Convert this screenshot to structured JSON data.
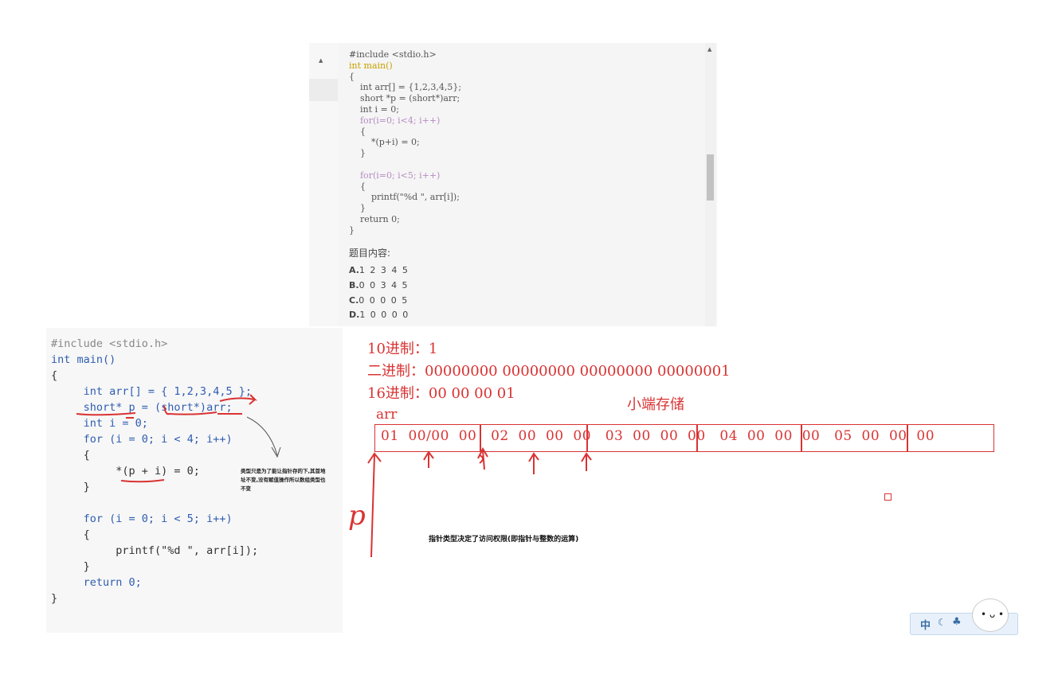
{
  "top_panel": {
    "code_lines": [
      "#include <stdio.h>",
      "int main()",
      "{",
      "    int arr[] = {1,2,3,4,5};",
      "    short *p = (short*)arr;",
      "    int i = 0;",
      "    for(i=0; i<4; i++)",
      "    {",
      "        *(p+i) = 0;",
      "    }",
      "",
      "    for(i=0; i<5; i++)",
      "    {",
      "        printf(\"%d \", arr[i]);",
      "    }",
      "    return 0;",
      "}"
    ],
    "question_label": "题目内容:",
    "options": [
      {
        "letter": "A.",
        "text": "1 2 3 4 5"
      },
      {
        "letter": "B.",
        "text": "0 0 3 4 5"
      },
      {
        "letter": "C.",
        "text": "0 0 0 0 5"
      },
      {
        "letter": "D.",
        "text": "1 0 0 0 0"
      }
    ]
  },
  "bottom_panel": {
    "code_lines": [
      "#include <stdio.h>",
      "int main()",
      "{",
      "     int arr[] = { 1,2,3,4,5 };",
      "     short* p = (short*)arr;",
      "     int i = 0;",
      "     for (i = 0; i < 4; i++)",
      "     {",
      "          *(p + i) = 0;",
      "     }",
      "",
      "     for (i = 0; i < 5; i++)",
      "     {",
      "          printf(\"%d \", arr[i]);",
      "     }",
      "     return 0;",
      "}"
    ],
    "note": "类型只是为了能让指针存的下,其首地址不变,没有赋值操作所以数组类型也不变"
  },
  "diagram": {
    "decimal_line": "10进制：1",
    "binary_line": "二进制：00000000 00000000 00000000 00000001",
    "hex_line": "16进制：00 00 00 01",
    "endian_label": "小端存储",
    "array_label": "arr",
    "memory_text": "01  00/00  00   02  00  00  00   03  00  00  00   04  00  00  00   05  00  00  00",
    "pointer_label": "p",
    "note": "指针类型决定了访问权限(即指针与整数的运算)"
  },
  "ime": {
    "text": "中 ",
    "icons": [
      "moon-icon",
      "shirt-icon"
    ]
  },
  "colors": {
    "annotation_red": "#d93333",
    "keyword_blue": "#2f5db0"
  }
}
